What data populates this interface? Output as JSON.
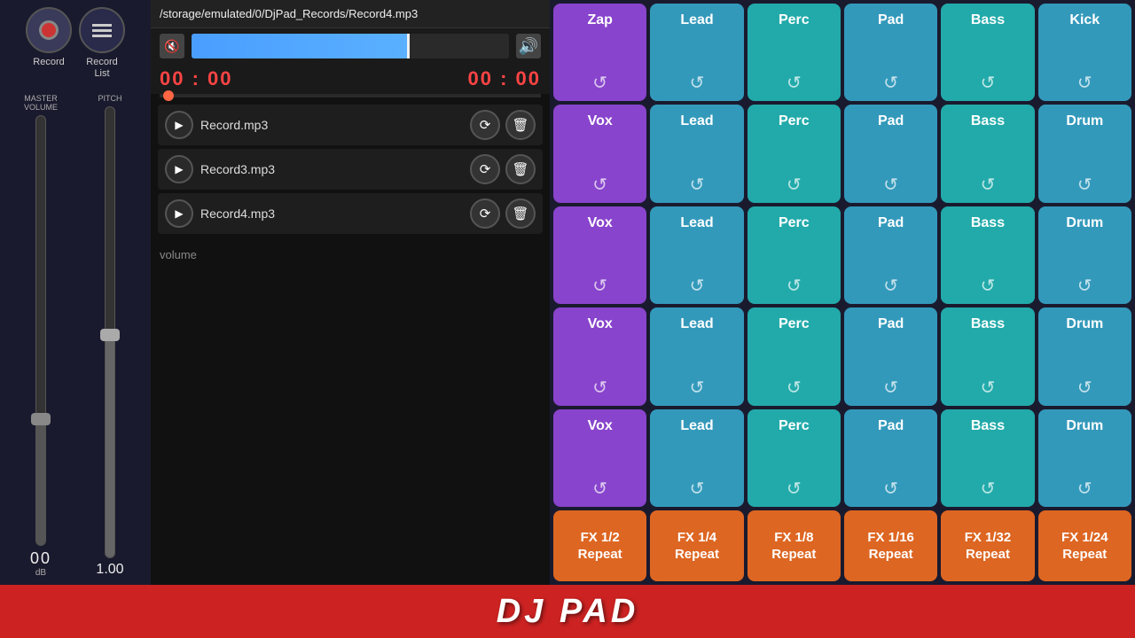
{
  "sidebar": {
    "record_label": "Record",
    "record_list_label": "Record\nList",
    "master_volume_label": "MASTER\nVOLUME",
    "pitch_label": "PITCH",
    "db_value": "00",
    "db_unit": "dB",
    "pitch_value": "1.00"
  },
  "record_area": {
    "file_path": "/storage/emulated/0/DjPad_Records/Record4.mp3",
    "time_current": "00 : 00",
    "time_total": "00 : 00",
    "files": [
      {
        "name": "Record.mp3"
      },
      {
        "name": "Record3.mp3"
      },
      {
        "name": "Record4.mp3"
      }
    ],
    "volume_label": "volume"
  },
  "pad_grid": {
    "rows": [
      [
        {
          "name": "Zap",
          "color": "purple"
        },
        {
          "name": "Lead",
          "color": "blue"
        },
        {
          "name": "Perc",
          "color": "teal"
        },
        {
          "name": "Pad",
          "color": "blue"
        },
        {
          "name": "Bass",
          "color": "teal"
        },
        {
          "name": "Kick",
          "color": "blue"
        }
      ],
      [
        {
          "name": "Vox",
          "color": "purple"
        },
        {
          "name": "Lead",
          "color": "blue"
        },
        {
          "name": "Perc",
          "color": "teal"
        },
        {
          "name": "Pad",
          "color": "blue"
        },
        {
          "name": "Bass",
          "color": "teal"
        },
        {
          "name": "Drum",
          "color": "blue"
        }
      ],
      [
        {
          "name": "Vox",
          "color": "purple"
        },
        {
          "name": "Lead",
          "color": "blue"
        },
        {
          "name": "Perc",
          "color": "teal"
        },
        {
          "name": "Pad",
          "color": "blue"
        },
        {
          "name": "Bass",
          "color": "teal"
        },
        {
          "name": "Drum",
          "color": "blue"
        }
      ],
      [
        {
          "name": "Vox",
          "color": "purple"
        },
        {
          "name": "Lead",
          "color": "blue"
        },
        {
          "name": "Perc",
          "color": "teal"
        },
        {
          "name": "Pad",
          "color": "blue"
        },
        {
          "name": "Bass",
          "color": "teal"
        },
        {
          "name": "Drum",
          "color": "blue"
        }
      ],
      [
        {
          "name": "Vox",
          "color": "purple"
        },
        {
          "name": "Lead",
          "color": "blue"
        },
        {
          "name": "Perc",
          "color": "teal"
        },
        {
          "name": "Pad",
          "color": "blue"
        },
        {
          "name": "Bass",
          "color": "teal"
        },
        {
          "name": "Drum",
          "color": "blue"
        }
      ]
    ],
    "fx_row": [
      {
        "line1": "FX 1/2",
        "line2": "Repeat"
      },
      {
        "line1": "FX 1/4",
        "line2": "Repeat"
      },
      {
        "line1": "FX 1/8",
        "line2": "Repeat"
      },
      {
        "line1": "FX 1/16",
        "line2": "Repeat"
      },
      {
        "line1": "FX 1/32",
        "line2": "Repeat"
      },
      {
        "line1": "FX 1/24",
        "line2": "Repeat"
      }
    ]
  },
  "bottom_bar": {
    "logo": "DJ PAD"
  }
}
